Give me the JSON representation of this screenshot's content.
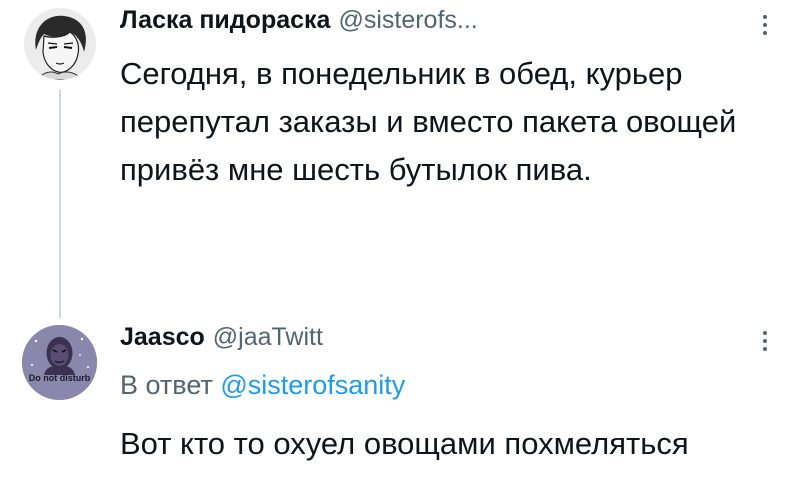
{
  "tweets": [
    {
      "display_name": "Ласка пидораска",
      "handle": "@sisterofs...",
      "text": "Сегодня, в понедельник в обед, курьер перепутал заказы и вместо пакета овощей привёз мне шесть бутылок пива.",
      "avatar_icon": "avatar-anime-character-sketch"
    },
    {
      "display_name": "Jaasco",
      "handle": "@jaaTwitt",
      "reply_prefix": "В ответ",
      "reply_mention": "@sisterofsanity",
      "text": "Вот кто то охуел овощами похмеляться",
      "avatar_icon": "avatar-wookiee-illustration",
      "avatar_caption": "Do not disturb"
    }
  ],
  "icons": {
    "more": "more-vertical-icon"
  },
  "colors": {
    "text_primary": "#0f1419",
    "text_secondary": "#536471",
    "link": "#1d9bf0",
    "thread_line": "#cfd9de",
    "avatar2_bg": "#8a87ad"
  }
}
